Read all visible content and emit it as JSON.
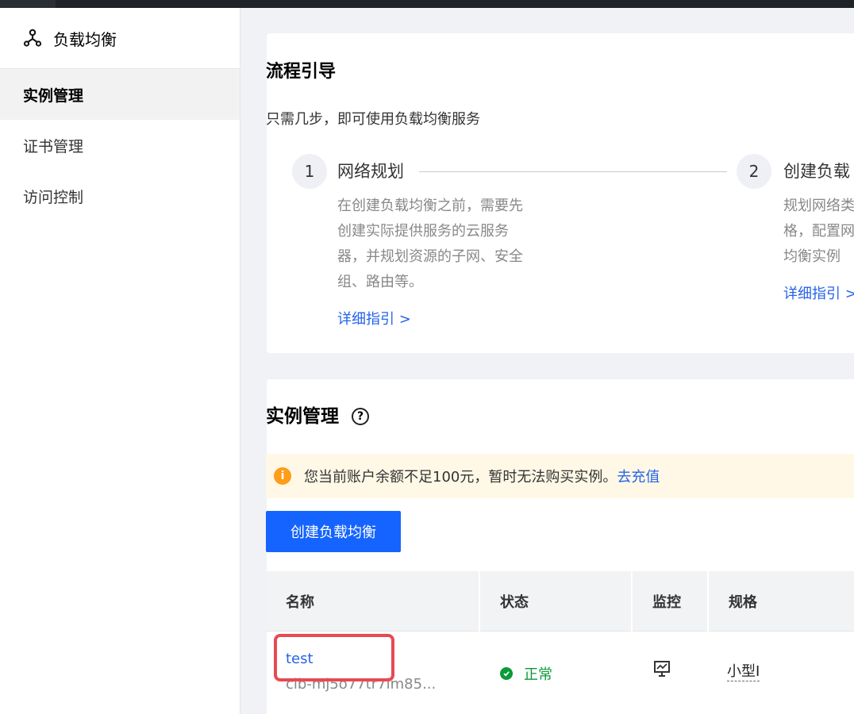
{
  "sidebar": {
    "title": "负载均衡",
    "items": [
      {
        "label": "实例管理"
      },
      {
        "label": "证书管理"
      },
      {
        "label": "访问控制"
      }
    ]
  },
  "guide": {
    "title": "流程引导",
    "subtitle": "只需几步，即可使用负载均衡服务",
    "steps": [
      {
        "num": "1",
        "name": "网络规划",
        "desc": [
          "在创建负载均衡之前，需要先",
          "创建实际提供服务的云服务",
          "器，并规划资源的子网、安全",
          "组、路由等。"
        ],
        "link": "详细指引 >"
      },
      {
        "num": "2",
        "name": "创建负载",
        "desc": [
          "规划网络类",
          "格，配置网",
          "均衡实例"
        ],
        "link": "详细指引 >"
      }
    ]
  },
  "instances": {
    "title": "实例管理",
    "help_icon": "?",
    "alert": {
      "icon": "i",
      "text": "您当前账户余额不足100元，暂时无法购买实例。",
      "link": "去充值"
    },
    "create_button": "创建负载均衡",
    "columns": [
      "名称",
      "状态",
      "监控",
      "规格"
    ],
    "rows": [
      {
        "name": "test",
        "id": "clb-mj5o77tr7im85...",
        "status": "正常",
        "spec": "小型I"
      }
    ]
  },
  "colors": {
    "primary": "#1664ff",
    "link": "#2563eb",
    "success": "#0a9b3a",
    "warning": "#ff9c19",
    "highlight": "#e84a52"
  }
}
